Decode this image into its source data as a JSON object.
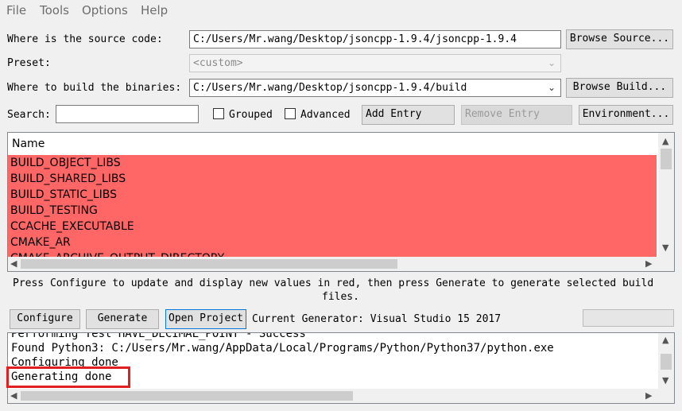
{
  "menu": [
    "File",
    "Tools",
    "Options",
    "Help"
  ],
  "source": {
    "label": "Where is the source code:",
    "value": "C:/Users/Mr.wang/Desktop/jsoncpp-1.9.4/jsoncpp-1.9.4",
    "browse": "Browse Source..."
  },
  "preset": {
    "label": "Preset:",
    "value": "<custom>"
  },
  "build": {
    "label": "Where to build the binaries:",
    "value": "C:/Users/Mr.wang/Desktop/jsoncpp-1.9.4/build",
    "browse": "Browse Build..."
  },
  "search": {
    "label": "Search:",
    "value": ""
  },
  "options": {
    "grouped": "Grouped",
    "advanced": "Advanced",
    "add_entry": "Add Entry",
    "remove_entry": "Remove Entry",
    "environment": "Environment..."
  },
  "table": {
    "header": "Name",
    "rows": [
      "BUILD_OBJECT_LIBS",
      "BUILD_SHARED_LIBS",
      "BUILD_STATIC_LIBS",
      "BUILD_TESTING",
      "CCACHE_EXECUTABLE",
      "CMAKE_AR",
      "CMAKE_ARCHIVE_OUTPUT_DIRECTORY"
    ]
  },
  "hint": {
    "line1": "Press Configure to update and display new values in red, then press Generate to generate selected build",
    "line2": "files."
  },
  "actions": {
    "configure": "Configure",
    "generate": "Generate",
    "open_project": "Open Project",
    "generator": "Current Generator: Visual Studio 15 2017"
  },
  "output": {
    "lines": [
      "Performing Test HAVE_DECIMAL_POINT - Success",
      "Found Python3: C:/Users/Mr.wang/AppData/Local/Programs/Python/Python37/python.exe",
      "Configuring done",
      "Generating done"
    ]
  },
  "colors": {
    "changed_row": "#ff6666",
    "highlight_box": "#e02020"
  }
}
